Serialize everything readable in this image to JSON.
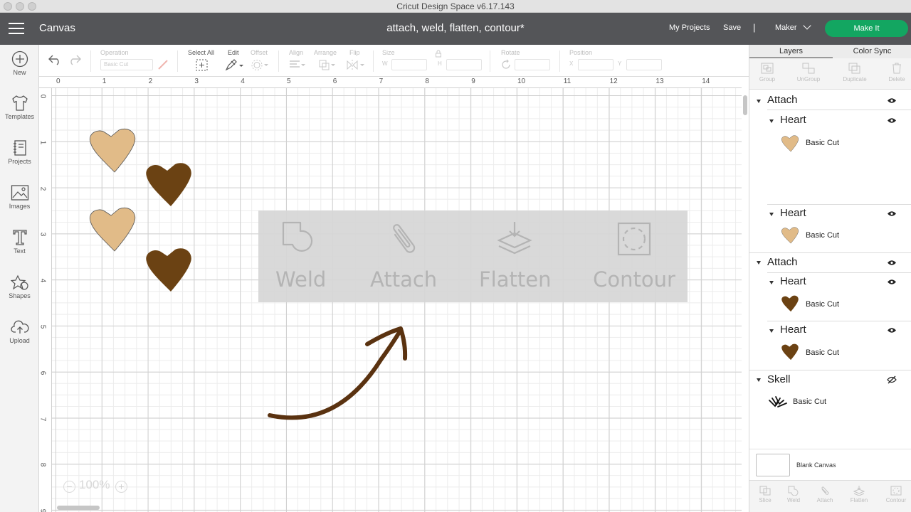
{
  "window": {
    "title": "Cricut Design Space  v6.17.143"
  },
  "header": {
    "section": "Canvas",
    "project_title": "attach, weld, flatten, contour*",
    "my_projects": "My Projects",
    "save": "Save",
    "separator": "|",
    "machine": "Maker",
    "make_it": "Make It"
  },
  "sidebar": {
    "items": [
      {
        "label": "New",
        "icon": "plus-circle-icon"
      },
      {
        "label": "Templates",
        "icon": "tshirt-icon"
      },
      {
        "label": "Projects",
        "icon": "notebook-icon"
      },
      {
        "label": "Images",
        "icon": "image-icon"
      },
      {
        "label": "Text",
        "icon": "text-icon"
      },
      {
        "label": "Shapes",
        "icon": "shapes-icon"
      },
      {
        "label": "Upload",
        "icon": "cloud-upload-icon"
      }
    ]
  },
  "toolbar": {
    "operation_label": "Operation",
    "operation_value": "Basic Cut",
    "select_all": "Select All",
    "edit": "Edit",
    "offset": "Offset",
    "align": "Align",
    "arrange": "Arrange",
    "flip": "Flip",
    "size": "Size",
    "w_label": "W",
    "h_label": "H",
    "rotate": "Rotate",
    "position": "Position",
    "x_label": "X",
    "y_label": "Y"
  },
  "ruler": {
    "horizontal": [
      "0",
      "1",
      "2",
      "3",
      "4",
      "5",
      "6",
      "7",
      "8",
      "9",
      "10",
      "11",
      "12",
      "13",
      "14"
    ],
    "vertical": [
      "0",
      "1",
      "2",
      "3",
      "4",
      "5",
      "6",
      "7",
      "8",
      "9"
    ]
  },
  "canvas": {
    "zoom": "100%",
    "zoom_out": "−",
    "zoom_in": "+",
    "overlay": [
      {
        "label": "Weld",
        "icon": "weld-icon"
      },
      {
        "label": "Attach",
        "icon": "paperclip-icon"
      },
      {
        "label": "Flatten",
        "icon": "flatten-icon"
      },
      {
        "label": "Contour",
        "icon": "contour-icon"
      }
    ],
    "colors": {
      "light_heart": "#e1bb88",
      "dark_heart": "#6b4213",
      "arrow": "#5a3210"
    }
  },
  "panel": {
    "tabs": [
      "Layers",
      "Color Sync"
    ],
    "tools": [
      "Group",
      "UnGroup",
      "Duplicate",
      "Delete"
    ],
    "groups": [
      {
        "name": "Attach",
        "children": [
          {
            "name": "Heart",
            "operation": "Basic Cut",
            "color": "#e1bb88"
          },
          {
            "name": "Heart",
            "operation": "Basic Cut",
            "color": "#e1bb88"
          }
        ]
      },
      {
        "name": "Attach",
        "children": [
          {
            "name": "Heart",
            "operation": "Basic Cut",
            "color": "#6b4213"
          },
          {
            "name": "Heart",
            "operation": "Basic Cut",
            "color": "#6b4213"
          }
        ]
      },
      {
        "name": "Skell",
        "operation": "Basic Cut",
        "hidden": true
      }
    ],
    "blank_canvas": "Blank Canvas",
    "bottom_tools": [
      "Slice",
      "Weld",
      "Attach",
      "Flatten",
      "Contour"
    ]
  }
}
